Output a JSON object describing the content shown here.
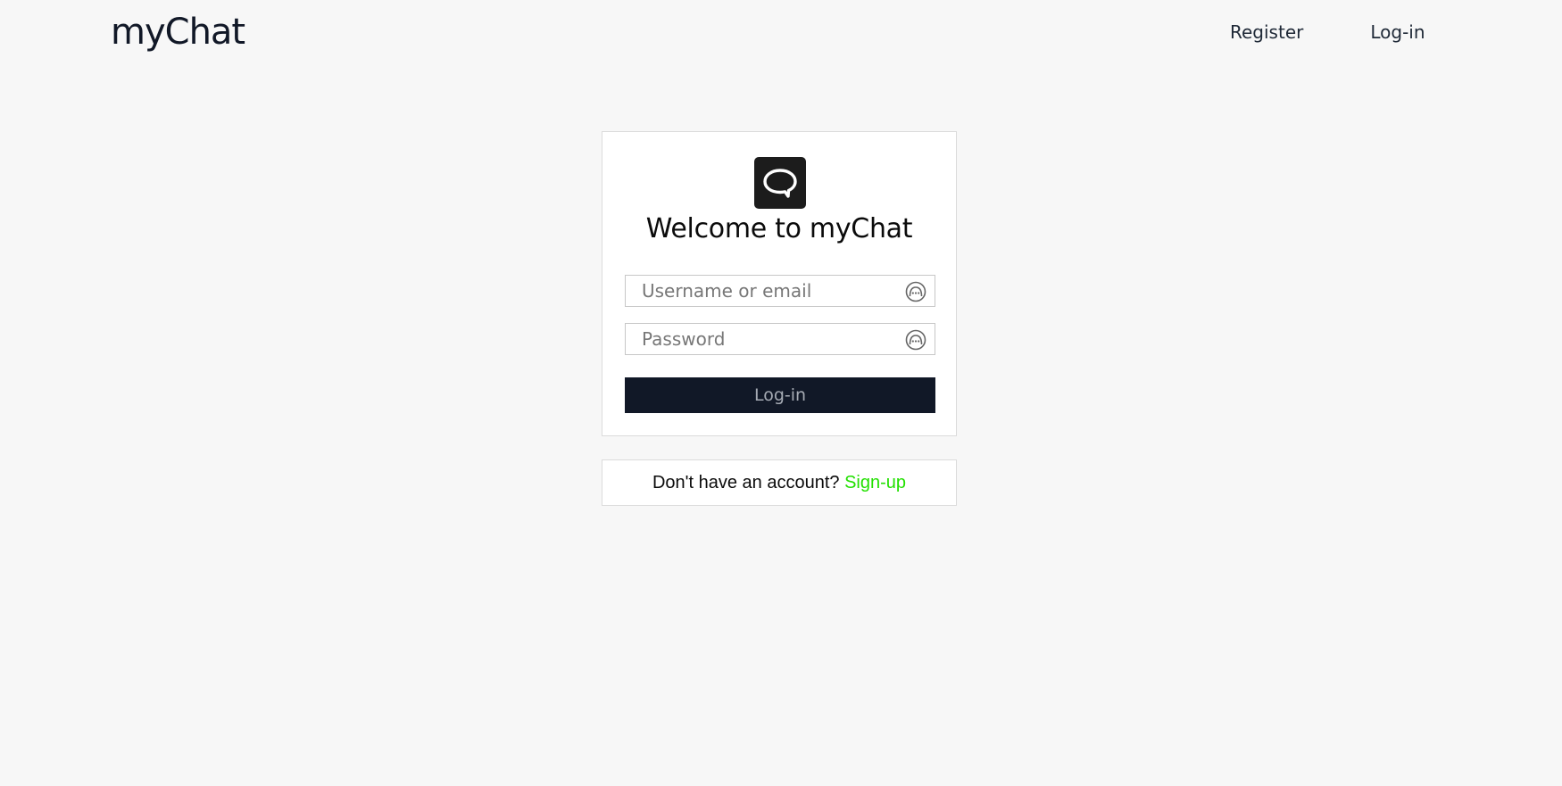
{
  "header": {
    "brand": "myChat",
    "nav": {
      "register_label": "Register",
      "login_label": "Log-in"
    }
  },
  "login_card": {
    "logo_icon": "speech-bubble-icon",
    "welcome_text": "Welcome to myChat",
    "username": {
      "placeholder": "Username or email",
      "value": "",
      "icon": "password-manager-icon"
    },
    "password": {
      "placeholder": "Password",
      "value": "",
      "icon": "password-manager-icon"
    },
    "submit_label": "Log-in"
  },
  "signup": {
    "prompt": "Don't have an account?",
    "link_label": "Sign-up"
  },
  "colors": {
    "background": "#f7f7f7",
    "primary_dark": "#111827",
    "link_green": "#22e000",
    "button_text": "#a6abb4"
  }
}
